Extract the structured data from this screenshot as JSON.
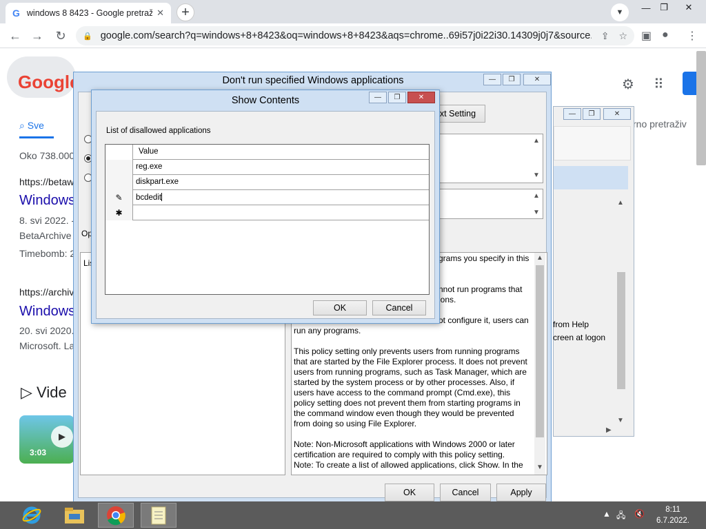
{
  "browser": {
    "tab_title": "windows 8 8423 - Google pretraž",
    "tab_close": "✕",
    "new_tab": "+",
    "url": "google.com/search?q=windows+8+8423&oq=windows+8+8423&aqs=chrome..69i57j0i22i30.14309j0j7&source...",
    "window_minimize": "—",
    "window_restore": "❐",
    "window_close": "✕"
  },
  "google": {
    "logo_text": "Google",
    "tab_all": "Sve",
    "results_count": "Oko 738.000",
    "result1_url": "https://betaw",
    "result1_title": "Windows",
    "result1_date": "8. svi 2022. -",
    "result1_snip": "BetaArchive",
    "result1_extra": "Timebomb: 2",
    "result2_url": "https://archiv",
    "result2_title": "Windows",
    "result2_date": "20. svi 2020.",
    "result2_snip": "Microsoft. La",
    "videos_heading": "Vide",
    "video_time": "3:03",
    "right_text": "rno pretraživ"
  },
  "policy_window": {
    "title": "Don't run specified Windows applications",
    "next_setting": "Next Setting",
    "options_label": "Op",
    "list_label": "Lis",
    "help_lines_1": "grams you specify in this",
    "help_lines_2": "nnot run programs that",
    "help_lines_3": "ions.",
    "help_lines_4": "ot configure it, users can",
    "help_para_1": "run any programs.",
    "help_para_2": "This policy setting only prevents users from running programs that are started by the File Explorer process. It does not prevent users from running programs, such as Task Manager, which are started by the system process or by other processes.  Also, if users have access to the command prompt (Cmd.exe), this policy setting does not prevent them from starting programs in the command window even though they would be prevented from doing so using File Explorer.",
    "help_para_3": "Note: Non-Microsoft applications with Windows 2000 or later certification are required to comply with this policy setting.",
    "help_para_4": "Note: To create a list of allowed applications, click Show.  In the",
    "side_text_1": "from Help",
    "side_text_2": "creen at logon",
    "ok": "OK",
    "cancel": "Cancel",
    "apply": "Apply"
  },
  "show_contents": {
    "title": "Show Contents",
    "label": "List of disallowed applications",
    "column_header": "Value",
    "rows": [
      {
        "marker": "",
        "value": "reg.exe"
      },
      {
        "marker": "",
        "value": "diskpart.exe"
      },
      {
        "marker": "✎",
        "value": "bcdedit"
      },
      {
        "marker": "✱",
        "value": ""
      }
    ],
    "ok": "OK",
    "cancel": "Cancel"
  },
  "taskbar": {
    "time": "8:11",
    "date": "6.7.2022."
  },
  "colors": {
    "accent_blue": "#1a73e8",
    "window_frame": "#cfe0f3",
    "close_red": "#c75050",
    "taskbar": "#5b5b5b"
  }
}
